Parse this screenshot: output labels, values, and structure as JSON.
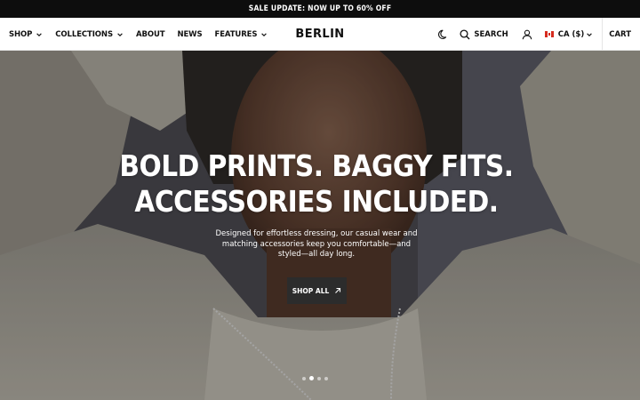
{
  "announcement": "SALE UPDATE: NOW UP TO 60% OFF",
  "nav": {
    "shop": "SHOP",
    "collections": "COLLECTIONS",
    "about": "ABOUT",
    "news": "NEWS",
    "features": "FEATURES"
  },
  "logo": "BERLIN",
  "header_right": {
    "search": "SEARCH",
    "currency": "CA ($)",
    "cart": "CART"
  },
  "icons": {
    "theme": "moon-icon",
    "search": "search-icon",
    "account": "user-icon",
    "flag": "canada-flag-icon",
    "cta": "arrow-up-right-icon"
  },
  "hero": {
    "headline_line1": "BOLD PRINTS. BAGGY FITS.",
    "headline_line2": "ACCESSORIES INCLUDED.",
    "subtext": "Designed for effortless dressing, our casual wear and matching accessories keep you comfortable—and styled—all day long.",
    "cta": "SHOP ALL",
    "slide_count": 4,
    "active_slide": 2
  },
  "colors": {
    "announcement_bg": "#0d0d0d",
    "header_bg": "#ffffff",
    "cta_bg": "#2c2c2c",
    "flag_red": "#d52b1e"
  }
}
